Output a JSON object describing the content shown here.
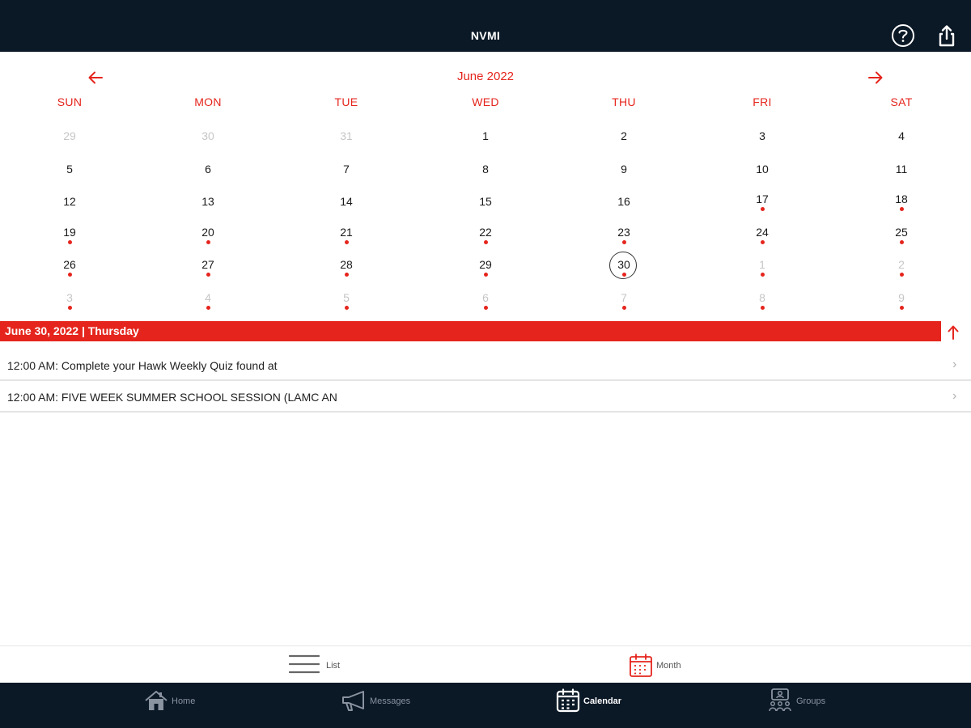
{
  "app": {
    "title": "NVMI"
  },
  "colors": {
    "accent": "#e5251d",
    "bar": "#0b1826"
  },
  "icons": {
    "help": "help-circle-icon",
    "share": "share-icon",
    "prev": "arrow-left-icon",
    "next": "arrow-right-icon",
    "collapse": "arrow-up-icon"
  },
  "calendar": {
    "month_label": "June 2022",
    "weekdays": [
      "SUN",
      "MON",
      "TUE",
      "WED",
      "THU",
      "FRI",
      "SAT"
    ],
    "weeks": [
      [
        {
          "d": "29",
          "other": true,
          "dot": false
        },
        {
          "d": "30",
          "other": true,
          "dot": false
        },
        {
          "d": "31",
          "other": true,
          "dot": false
        },
        {
          "d": "1",
          "other": false,
          "dot": false
        },
        {
          "d": "2",
          "other": false,
          "dot": false
        },
        {
          "d": "3",
          "other": false,
          "dot": false
        },
        {
          "d": "4",
          "other": false,
          "dot": false
        }
      ],
      [
        {
          "d": "5",
          "other": false,
          "dot": false
        },
        {
          "d": "6",
          "other": false,
          "dot": false
        },
        {
          "d": "7",
          "other": false,
          "dot": false
        },
        {
          "d": "8",
          "other": false,
          "dot": false
        },
        {
          "d": "9",
          "other": false,
          "dot": false
        },
        {
          "d": "10",
          "other": false,
          "dot": false
        },
        {
          "d": "11",
          "other": false,
          "dot": false
        }
      ],
      [
        {
          "d": "12",
          "other": false,
          "dot": false
        },
        {
          "d": "13",
          "other": false,
          "dot": false
        },
        {
          "d": "14",
          "other": false,
          "dot": false
        },
        {
          "d": "15",
          "other": false,
          "dot": false
        },
        {
          "d": "16",
          "other": false,
          "dot": false
        },
        {
          "d": "17",
          "other": false,
          "dot": true
        },
        {
          "d": "18",
          "other": false,
          "dot": true
        }
      ],
      [
        {
          "d": "19",
          "other": false,
          "dot": true
        },
        {
          "d": "20",
          "other": false,
          "dot": true
        },
        {
          "d": "21",
          "other": false,
          "dot": true
        },
        {
          "d": "22",
          "other": false,
          "dot": true
        },
        {
          "d": "23",
          "other": false,
          "dot": true
        },
        {
          "d": "24",
          "other": false,
          "dot": true
        },
        {
          "d": "25",
          "other": false,
          "dot": true
        }
      ],
      [
        {
          "d": "26",
          "other": false,
          "dot": true
        },
        {
          "d": "27",
          "other": false,
          "dot": true
        },
        {
          "d": "28",
          "other": false,
          "dot": true
        },
        {
          "d": "29",
          "other": false,
          "dot": true
        },
        {
          "d": "30",
          "other": false,
          "dot": true,
          "selected": true
        },
        {
          "d": "1",
          "other": true,
          "dot": true
        },
        {
          "d": "2",
          "other": true,
          "dot": true
        }
      ],
      [
        {
          "d": "3",
          "other": true,
          "dot": true
        },
        {
          "d": "4",
          "other": true,
          "dot": true
        },
        {
          "d": "5",
          "other": true,
          "dot": true
        },
        {
          "d": "6",
          "other": true,
          "dot": true
        },
        {
          "d": "7",
          "other": true,
          "dot": true
        },
        {
          "d": "8",
          "other": true,
          "dot": true
        },
        {
          "d": "9",
          "other": true,
          "dot": true
        }
      ]
    ]
  },
  "selected_day": {
    "label": "June 30, 2022 | Thursday"
  },
  "events": [
    {
      "text": "12:00 AM: Complete your Hawk Weekly Quiz found at"
    },
    {
      "text": "12:00 AM: FIVE WEEK SUMMER SCHOOL SESSION (LAMC AN"
    }
  ],
  "view_switch": {
    "list_label": "List",
    "month_label": "Month",
    "active": "Month"
  },
  "tabs": [
    {
      "label": "Home",
      "icon": "home-icon",
      "active": false
    },
    {
      "label": "Messages",
      "icon": "megaphone-icon",
      "active": false
    },
    {
      "label": "Calendar",
      "icon": "calendar-icon",
      "active": true
    },
    {
      "label": "Groups",
      "icon": "groups-icon",
      "active": false
    }
  ]
}
